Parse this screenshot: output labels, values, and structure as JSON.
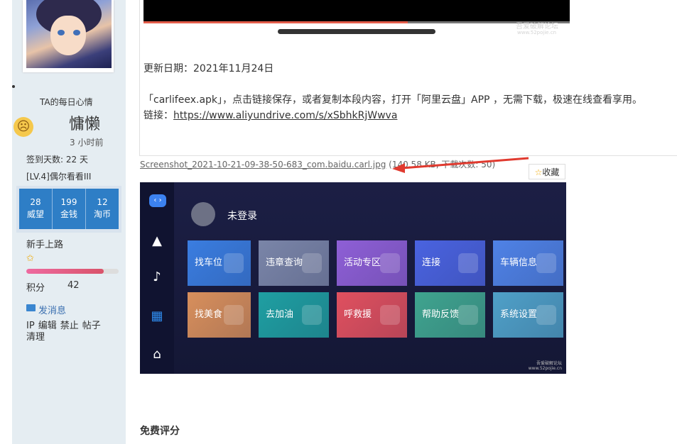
{
  "sidebar": {
    "mood_label": "TA的每日心情",
    "mood_word": "慵懒",
    "mood_time": "3 小时前",
    "sign_days": "签到天数: 22 天",
    "level": "[LV.4]偶尔看看III",
    "stats": [
      {
        "value": "28",
        "label": "威望"
      },
      {
        "value": "199",
        "label": "金钱"
      },
      {
        "value": "12",
        "label": "淘币"
      }
    ],
    "group": "新手上路",
    "progress": 0.84,
    "points_label": "积分",
    "points_value": "42",
    "send_message": "发消息",
    "admin_links": [
      "IP",
      "编辑",
      "禁止",
      "帖子",
      "清理"
    ]
  },
  "post": {
    "watermark_line1": "吾爱破解论坛",
    "watermark_line2": "www.52pojie.cn",
    "update_date": "更新日期：2021年11月24日",
    "share_text": "「carlifeex.apk」，点击链接保存，或者复制本段内容，打开「阿里云盘」APP ，无需下载，极速在线查看享用。",
    "link_prefix": "链接：",
    "link_url": "https://www.aliyundrive.com/s/xSbhkRjWwva",
    "attachment_name": "Screenshot_2021-10-21-09-38-50-683_com.baidu.carl.jpg",
    "attachment_meta": "(140.58 KB, 下载次数: 50)",
    "favorite_label": "收藏",
    "rating_title": "免费评分"
  },
  "car_app": {
    "login_text": "未登录",
    "tiles": [
      {
        "label": "找车位",
        "color": "#3a7de0"
      },
      {
        "label": "违章查询",
        "color": "#7a85a8"
      },
      {
        "label": "活动专区",
        "color": "#8e5fd6"
      },
      {
        "label": "连接",
        "color": "#4a63e0"
      },
      {
        "label": "车辆信息",
        "color": "#4f82e6"
      },
      {
        "label": "找美食",
        "color": "#d88f5c"
      },
      {
        "label": "去加油",
        "color": "#1f9fa2"
      },
      {
        "label": "呼救援",
        "color": "#e0505f"
      },
      {
        "label": "帮助反馈",
        "color": "#3fa48f"
      },
      {
        "label": "系统设置",
        "color": "#4fa0c8"
      }
    ],
    "watermark_line1": "吾爱破解论坛",
    "watermark_line2": "www.52pojie.cn"
  }
}
